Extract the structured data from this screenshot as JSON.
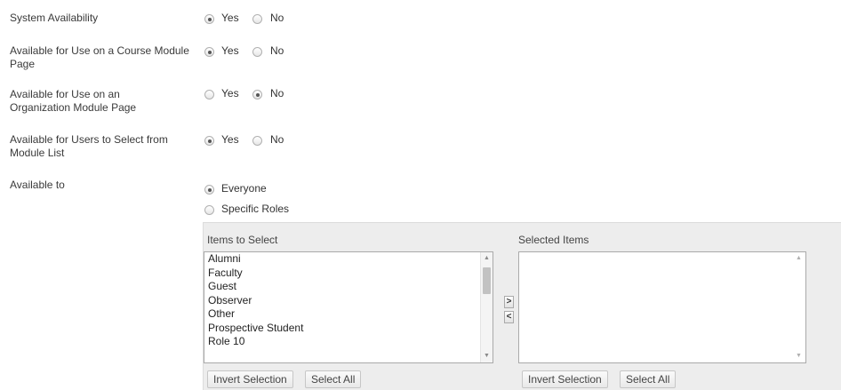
{
  "rows": [
    {
      "label": "System Availability",
      "yes": "Yes",
      "no": "No",
      "selected": "yes"
    },
    {
      "label": "Available for Use on a Course Module Page",
      "yes": "Yes",
      "no": "No",
      "selected": "yes"
    },
    {
      "label": "Available for Use on an Organization Module Page",
      "yes": "Yes",
      "no": "No",
      "selected": "no"
    },
    {
      "label": "Available for Users to Select from Module List",
      "yes": "Yes",
      "no": "No",
      "selected": "yes"
    }
  ],
  "available_to": {
    "label": "Available to",
    "options": [
      {
        "text": "Everyone",
        "selected": true
      },
      {
        "text": "Specific Roles",
        "selected": false
      }
    ]
  },
  "picker": {
    "items_title": "Items to Select",
    "selected_title": "Selected Items",
    "items": [
      "Alumni",
      "Faculty",
      "Guest",
      "Observer",
      "Other",
      "Prospective Student",
      "Role 10"
    ],
    "selected_items": [],
    "move_right": ">",
    "move_left": "<",
    "invert_selection": "Invert Selection",
    "select_all": "Select All"
  }
}
